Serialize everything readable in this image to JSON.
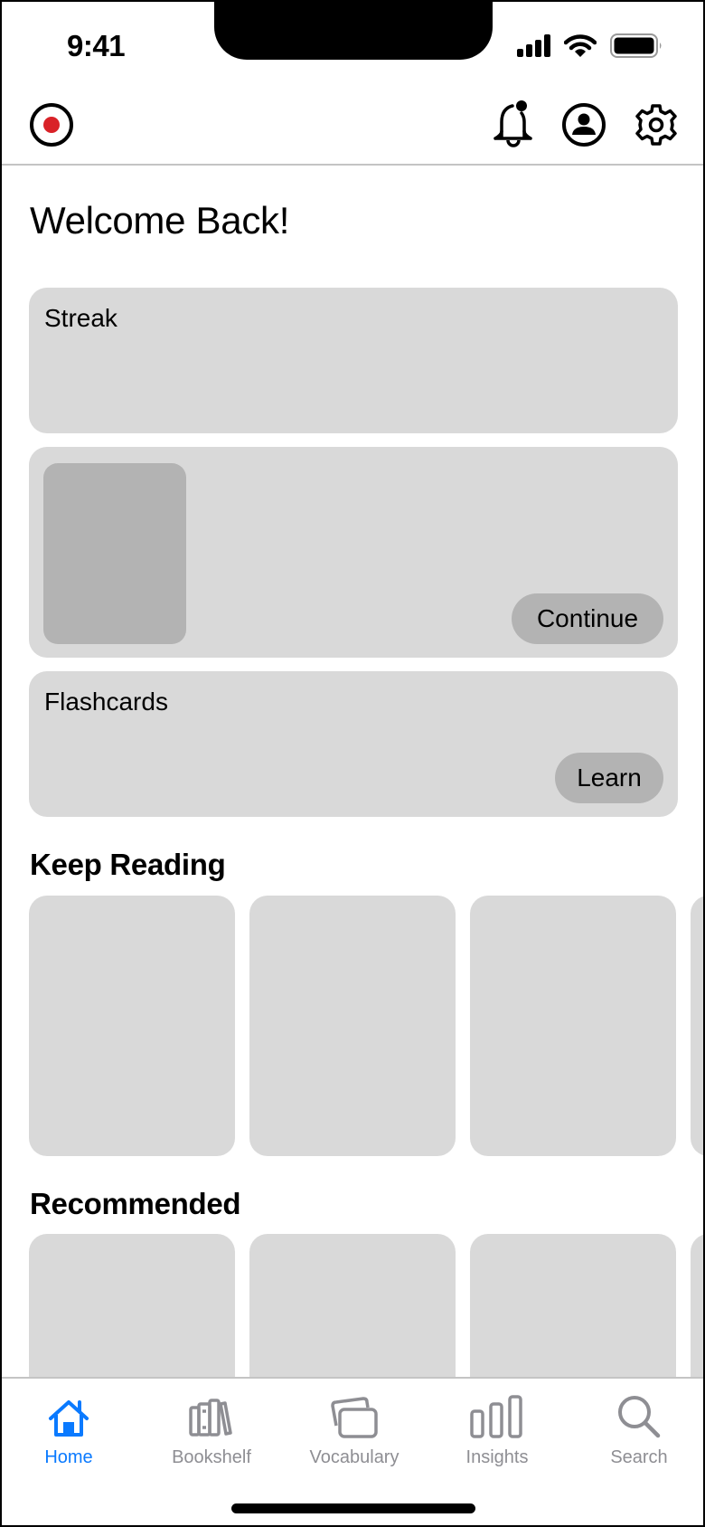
{
  "status_bar": {
    "time": "9:41",
    "icons": [
      "cellular-signal-icon",
      "wifi-icon",
      "battery-icon"
    ]
  },
  "header": {
    "logo_icon": "record-logo-icon",
    "logo_accent_color": "#d92228",
    "actions": [
      {
        "name": "notifications",
        "icon": "bell-icon",
        "has_badge": true
      },
      {
        "name": "profile",
        "icon": "profile-icon"
      },
      {
        "name": "settings",
        "icon": "gear-icon"
      }
    ]
  },
  "main": {
    "welcome_title": "Welcome Back!",
    "streak_card": {
      "label": "Streak"
    },
    "continue_card": {
      "button_label": "Continue"
    },
    "flashcards_card": {
      "label": "Flashcards",
      "button_label": "Learn"
    },
    "keep_reading": {
      "title": "Keep Reading",
      "item_count_visible": 4
    },
    "recommended": {
      "title": "Recommended",
      "item_count_visible": 4
    }
  },
  "tab_bar": {
    "active_color": "#0a7aff",
    "inactive_color": "#8e8e93",
    "tabs": [
      {
        "label": "Home",
        "icon": "home-icon",
        "active": true
      },
      {
        "label": "Bookshelf",
        "icon": "bookshelf-icon",
        "active": false
      },
      {
        "label": "Vocabulary",
        "icon": "vocabulary-cards-icon",
        "active": false
      },
      {
        "label": "Insights",
        "icon": "insights-chart-icon",
        "active": false
      },
      {
        "label": "Search",
        "icon": "search-icon",
        "active": false
      }
    ]
  }
}
